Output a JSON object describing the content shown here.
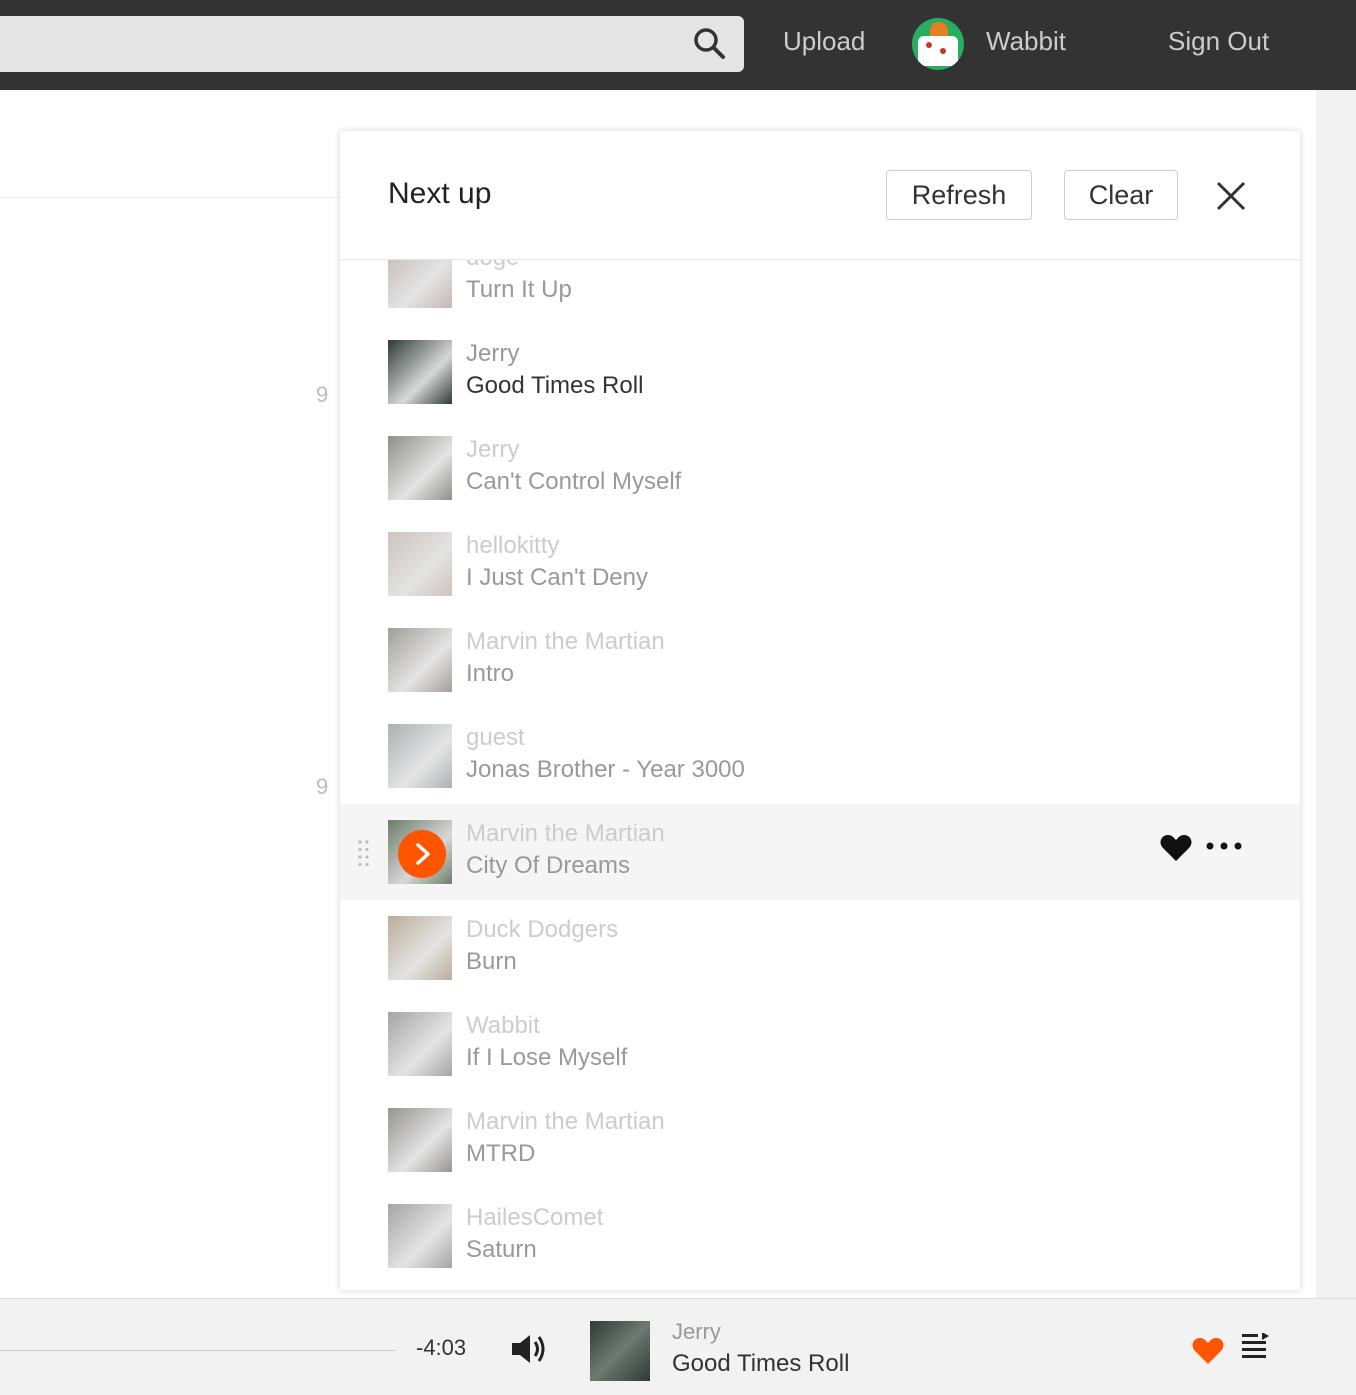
{
  "topbar": {
    "search_placeholder": "",
    "upload_label": "Upload",
    "username": "Wabbit",
    "signout_label": "Sign Out"
  },
  "background": {
    "numbers": [
      "9",
      "9"
    ]
  },
  "panel": {
    "title": "Next up",
    "refresh_label": "Refresh",
    "clear_label": "Clear"
  },
  "queue": [
    {
      "artist": "doge",
      "title": "Turn It Up",
      "state": "faded",
      "thumb_color": "#a89a96"
    },
    {
      "artist": "Jerry",
      "title": "Good Times Roll",
      "state": "current",
      "thumb_color": "#2e3a36"
    },
    {
      "artist": "Jerry",
      "title": "Can't Control Myself",
      "state": "faded",
      "thumb_color": "#5e5e58"
    },
    {
      "artist": "hellokitty",
      "title": "I Just Can't Deny",
      "state": "faded",
      "thumb_color": "#b6a9a0"
    },
    {
      "artist": "Marvin the Martian",
      "title": "Intro",
      "state": "faded",
      "thumb_color": "#7a746e"
    },
    {
      "artist": "guest",
      "title": "Jonas Brother - Year 3000",
      "state": "faded",
      "thumb_color": "#8a8f93"
    },
    {
      "artist": "Marvin the Martian",
      "title": "City Of Dreams",
      "state": "hover",
      "thumb_color": "#6c7d6a"
    },
    {
      "artist": "Duck Dodgers",
      "title": "Burn",
      "state": "faded",
      "thumb_color": "#9c8a6e"
    },
    {
      "artist": "Wabbit",
      "title": "If I Lose Myself",
      "state": "faded",
      "thumb_color": "#7d7d7d"
    },
    {
      "artist": "Marvin the Martian",
      "title": "MTRD",
      "state": "faded",
      "thumb_color": "#6b6663"
    },
    {
      "artist": "HailesComet",
      "title": "Saturn",
      "state": "faded",
      "thumb_color": "#7d7d7d"
    }
  ],
  "player": {
    "time_remaining": "-4:03",
    "artist": "Jerry",
    "title": "Good Times Roll",
    "accent_color": "#ff5500"
  }
}
